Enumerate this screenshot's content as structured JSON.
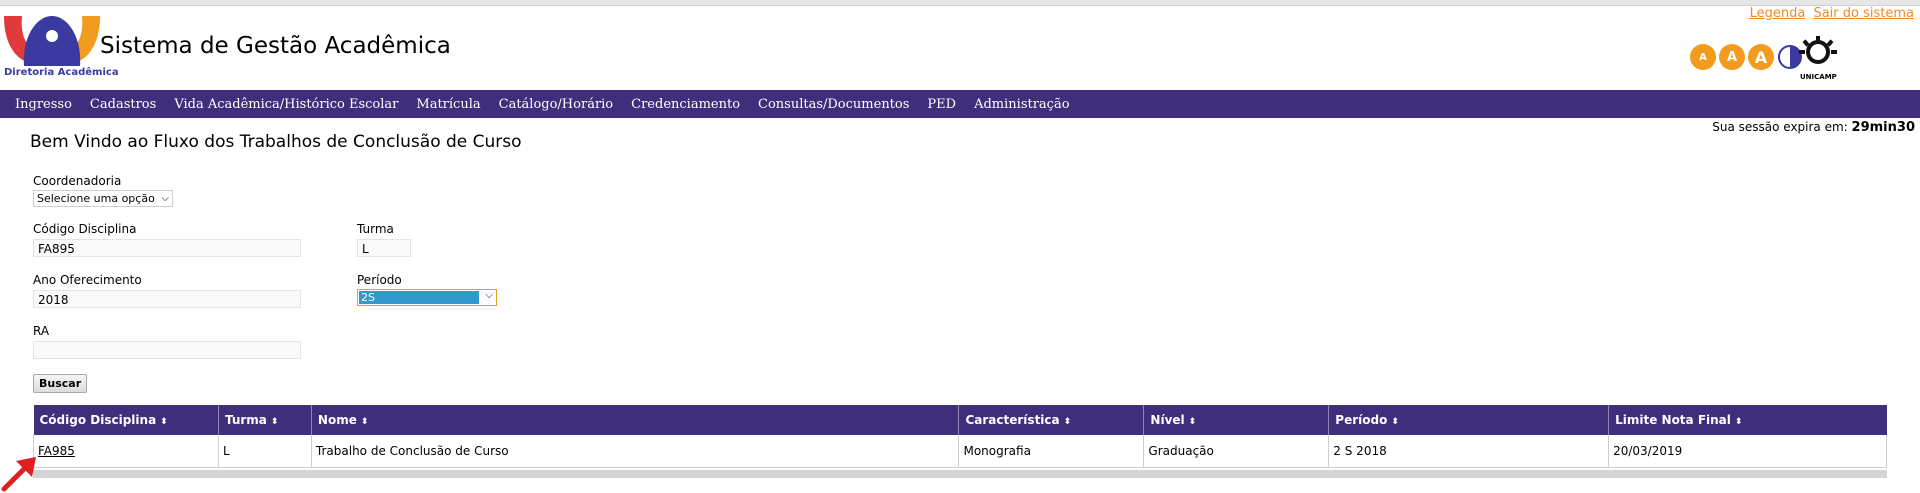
{
  "header": {
    "logo_caption": "Diretoria Acadêmica",
    "app_title": "Sistema de Gestão Acadêmica",
    "links": [
      "Legenda",
      "Sair do sistema"
    ],
    "accessibility_letters": [
      "A",
      "A",
      "A"
    ],
    "unicamp_caption": "UNICAMP",
    "colors": {
      "accent_orange": "#f39b1e",
      "nav_purple": "#3f2e7c",
      "logo_blue": "#3b3aa0"
    }
  },
  "nav": {
    "items": [
      "Ingresso",
      "Cadastros",
      "Vida Acadêmica/Histórico Escolar",
      "Matrícula",
      "Catálogo/Horário",
      "Credenciamento",
      "Consultas/Documentos",
      "PED",
      "Administração"
    ]
  },
  "session": {
    "label": "Sua sessão expira em:",
    "time": "29min30"
  },
  "page": {
    "welcome": "Bem Vindo ao Fluxo dos Trabalhos de Conclusão de Curso"
  },
  "form": {
    "coordenadoria": {
      "label": "Coordenadoria",
      "value": "Selecione uma opção"
    },
    "codigo": {
      "label": "Código Disciplina",
      "value": "FA895"
    },
    "turma": {
      "label": "Turma",
      "value": "L"
    },
    "ano": {
      "label": "Ano Oferecimento",
      "value": "2018"
    },
    "periodo": {
      "label": "Período",
      "value": "2S"
    },
    "ra": {
      "label": "RA",
      "value": ""
    },
    "search_button": "Buscar"
  },
  "table": {
    "headers": [
      "Código Disciplina",
      "Turma",
      "Nome",
      "Característica",
      "Nível",
      "Período",
      "Limite Nota Final"
    ],
    "rows": [
      [
        "FA985",
        "L",
        "Trabalho de Conclusão de Curso",
        "Monografia",
        "Graduação",
        "2 S 2018",
        "20/03/2019"
      ]
    ]
  }
}
